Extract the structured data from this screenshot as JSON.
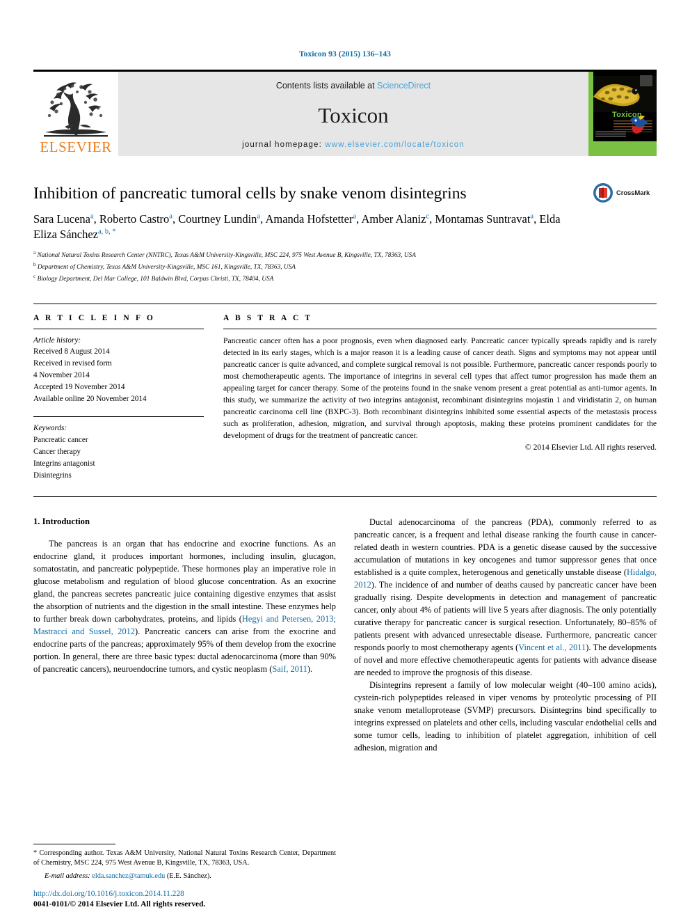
{
  "running_head": "Toxicon 93 (2015) 136–143",
  "masthead": {
    "publisher_name": "ELSEVIER",
    "contents_prefix": "Contents lists available at ",
    "contents_link": "ScienceDirect",
    "journal_name": "Toxicon",
    "homepage_label": "journal homepage: ",
    "homepage_url": "www.elsevier.com/locate/toxicon",
    "cover_title": "Toxicon"
  },
  "article": {
    "title": "Inhibition of pancreatic tumoral cells by snake venom disintegrins",
    "crossmark_label": "CrossMark",
    "authors": [
      {
        "name": "Sara Lucena",
        "marks": "a",
        "sep": ", "
      },
      {
        "name": "Roberto Castro",
        "marks": "a",
        "sep": ", "
      },
      {
        "name": "Courtney Lundin",
        "marks": "a",
        "sep": ", "
      },
      {
        "name": "Amanda Hofstetter",
        "marks": "a",
        "sep": ", "
      },
      {
        "name": "Amber Alaniz",
        "marks": "c",
        "sep": ", "
      },
      {
        "name": "Montamas Suntravat",
        "marks": "a",
        "sep": ", "
      },
      {
        "name": "Elda Eliza Sánchez",
        "marks": "a, b, *",
        "sep": ""
      }
    ],
    "affiliations": [
      {
        "mark": "a",
        "text": "National Natural Toxins Research Center (NNTRC), Texas A&M University-Kingsville, MSC 224, 975 West Avenue B, Kingsville, TX, 78363, USA"
      },
      {
        "mark": "b",
        "text": "Department of Chemistry, Texas A&M University-Kingsville, MSC 161, Kingsville, TX, 78363, USA"
      },
      {
        "mark": "c",
        "text": "Biology Department, Del Mar College, 101 Baldwin Blvd, Corpus Christi, TX, 78404, USA"
      }
    ]
  },
  "article_info": {
    "heading": "A R T I C L E   I N F O",
    "history_label": "Article history:",
    "history": [
      "Received 8 August 2014",
      "Received in revised form",
      "4 November 2014",
      "Accepted 19 November 2014",
      "Available online 20 November 2014"
    ],
    "keywords_label": "Keywords:",
    "keywords": [
      "Pancreatic cancer",
      "Cancer therapy",
      "Integrins antagonist",
      "Disintegrins"
    ]
  },
  "abstract": {
    "heading": "A B S T R A C T",
    "text": "Pancreatic cancer often has a poor prognosis, even when diagnosed early. Pancreatic cancer typically spreads rapidly and is rarely detected in its early stages, which is a major reason it is a leading cause of cancer death. Signs and symptoms may not appear until pancreatic cancer is quite advanced, and complete surgical removal is not possible. Furthermore, pancreatic cancer responds poorly to most chemotherapeutic agents. The importance of integrins in several cell types that affect tumor progression has made them an appealing target for cancer therapy. Some of the proteins found in the snake venom present a great potential as anti-tumor agents. In this study, we summarize the activity of two integrins antagonist, recombinant disintegrins mojastin 1 and viridistatin 2, on human pancreatic carcinoma cell line (BXPC-3). Both recombinant disintegrins inhibited some essential aspects of the metastasis process such as proliferation, adhesion, migration, and survival through apoptosis, making these proteins prominent candidates for the development of drugs for the treatment of pancreatic cancer.",
    "copyright": "© 2014 Elsevier Ltd. All rights reserved."
  },
  "body": {
    "section_title": "1. Introduction",
    "left_p1_a": "The pancreas is an organ that has endocrine and exocrine functions. As an endocrine gland, it produces important hormones, including insulin, glucagon, somatostatin, and pancreatic polypeptide. These hormones play an imperative role in glucose metabolism and regulation of blood glucose concentration. As an exocrine gland, the pancreas secretes pancreatic juice containing digestive enzymes that assist the absorption of nutrients and the digestion in the small intestine. These enzymes help to further break down carbohydrates, proteins, and lipids (",
    "left_p1_cite1": "Hegyi and Petersen, 2013; Mastracci and Sussel, 2012",
    "left_p1_b": "). Pancreatic cancers can arise from the exocrine and endocrine parts of the pancreas; approximately 95% of them develop from the exocrine portion. In general, there are three basic types: ductal adenocarcinoma (more than 90% of pancreatic cancers), neuroendocrine tumors, and cystic neoplasm (",
    "left_p1_cite2": "Saif, 2011",
    "left_p1_c": ").",
    "right_p1_a": "Ductal adenocarcinoma of the pancreas (PDA), commonly referred to as pancreatic cancer, is a frequent and lethal disease ranking the fourth cause in cancer-related death in western countries. PDA is a genetic disease caused by the successive accumulation of mutations in key oncogenes and tumor suppressor genes that once established is a quite complex, heterogenous and genetically unstable disease (",
    "right_p1_cite1": "Hidalgo, 2012",
    "right_p1_b": "). The incidence of and number of deaths caused by pancreatic cancer have been gradually rising. Despite developments in detection and management of pancreatic cancer, only about 4% of patients will live 5 years after diagnosis. The only potentially curative therapy for pancreatic cancer is surgical resection. Unfortunately, 80–85% of patients present with advanced unresectable disease. Furthermore, pancreatic cancer responds poorly to most chemotherapy agents (",
    "right_p1_cite2": "Vincent et al., 2011",
    "right_p1_c": "). The developments of novel and more effective chemotherapeutic agents for patients with advance disease are needed to improve the prognosis of this disease.",
    "right_p2": "Disintegrins represent a family of low molecular weight (40–100 amino acids), cystein-rich polypeptides released in viper venoms by proteolytic processing of PII snake venom metalloprotease (SVMP) precursors. Disintegrins bind specifically to integrins expressed on platelets and other cells, including vascular endothelial cells and some tumor cells, leading to inhibition of platelet aggregation, inhibition of cell adhesion, migration and"
  },
  "footer": {
    "corr_marker": "*",
    "corr_text": " Corresponding author. Texas A&M University, National Natural Toxins Research Center, Department of Chemistry, MSC 224, 975 West Avenue B, Kingsville, TX, 78363, USA.",
    "email_label": "E-mail address:",
    "email": "elda.sanchez@tamuk.edu",
    "email_suffix": " (E.E. Sánchez).",
    "doi": "http://dx.doi.org/10.1016/j.toxicon.2014.11.228",
    "issn_copyright": "0041-0101/© 2014 Elsevier Ltd. All rights reserved."
  },
  "colors": {
    "link_blue": "#0b6ba4",
    "sciencedirect_blue": "#4ba3d8",
    "elsevier_orange": "#ef7c1a",
    "cover_green": "#7ac143"
  }
}
